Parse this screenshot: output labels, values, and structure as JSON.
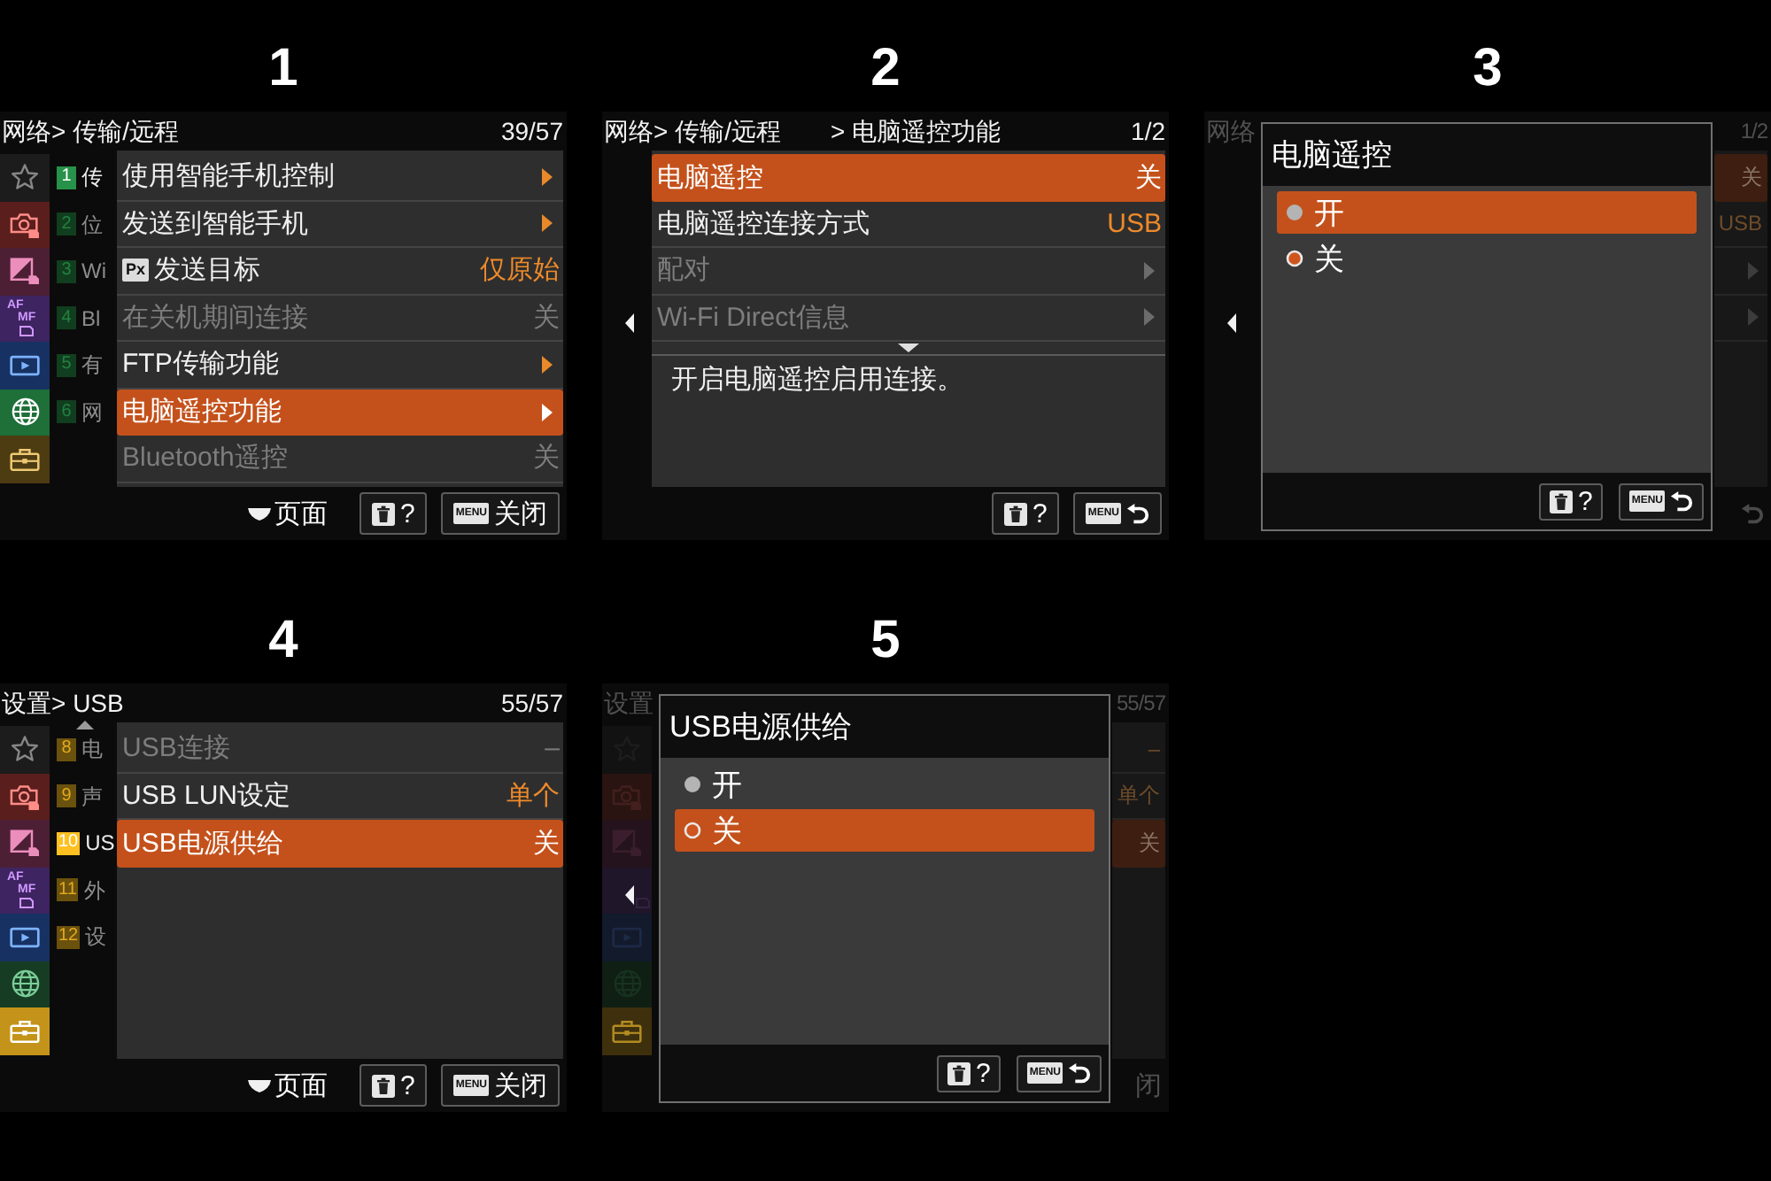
{
  "panels": [
    {
      "number": "1",
      "kind": "menu",
      "header": {
        "breadcrumb": [
          "网络> 传输/远程"
        ],
        "page": "39/57"
      },
      "categories": [
        {
          "kind": "favorites",
          "color": "#1c1c1c",
          "selected": false
        },
        {
          "kind": "camera",
          "color": "#5a1e1c",
          "selected": false
        },
        {
          "kind": "exposure",
          "color": "#4c1f35",
          "selected": false
        },
        {
          "kind": "focus",
          "color": "#3e2461",
          "selected": false,
          "texts": [
            "AF",
            "MF"
          ]
        },
        {
          "kind": "playback",
          "color": "#173162",
          "selected": false
        },
        {
          "kind": "network",
          "color": "#1e7038",
          "selected": true
        },
        {
          "kind": "setup",
          "color": "#4d3b12",
          "selected": false
        }
      ],
      "groups": [
        {
          "number": "1",
          "label": "传",
          "selected": true
        },
        {
          "number": "2",
          "label": "位",
          "selected": false
        },
        {
          "number": "3",
          "label": "Wi",
          "selected": false
        },
        {
          "number": "4",
          "label": "Bl",
          "selected": false
        },
        {
          "number": "5",
          "label": "有",
          "selected": false
        },
        {
          "number": "6",
          "label": "网",
          "selected": false
        }
      ],
      "rows": [
        {
          "kind": "submenu",
          "label": "使用智能手机控制",
          "selected": false,
          "disabled": false
        },
        {
          "kind": "submenu",
          "label": "发送到智能手机",
          "selected": false,
          "disabled": false
        },
        {
          "kind": "value",
          "tag": "Px",
          "label": "发送目标",
          "value": "仅原始",
          "selected": false,
          "disabled": false
        },
        {
          "kind": "value",
          "label": "在关机期间连接",
          "value": "关",
          "selected": false,
          "disabled": true
        },
        {
          "kind": "submenu",
          "label": "FTP传输功能",
          "selected": false,
          "disabled": false
        },
        {
          "kind": "submenu",
          "label": "电脑遥控功能",
          "selected": true,
          "disabled": false
        },
        {
          "kind": "value",
          "label": "Bluetooth遥控",
          "value": "关",
          "selected": false,
          "disabled": true
        }
      ],
      "footer": {
        "hint": "页面",
        "buttons": [
          {
            "kind": "help",
            "text": "?"
          },
          {
            "kind": "close",
            "tag": "MENU",
            "text": "关闭"
          }
        ]
      }
    },
    {
      "number": "2",
      "kind": "menu",
      "left_arrow": true,
      "header": {
        "breadcrumb": [
          "网络> 传输/远程",
          "> 电脑遥控功能"
        ],
        "page": "1/2"
      },
      "rows": [
        {
          "kind": "value",
          "label": "电脑遥控",
          "value": "关",
          "selected": true,
          "disabled": false
        },
        {
          "kind": "value",
          "label": "电脑遥控连接方式",
          "value": "USB",
          "selected": false,
          "disabled": false
        },
        {
          "kind": "submenu",
          "label": "配对",
          "selected": false,
          "disabled": true
        },
        {
          "kind": "submenu",
          "label": "Wi-Fi Direct信息",
          "selected": false,
          "disabled": true
        }
      ],
      "more_below": true,
      "description": "开启电脑遥控启用连接。",
      "footer": {
        "buttons": [
          {
            "kind": "help",
            "text": "?"
          },
          {
            "kind": "back",
            "tag": "MENU"
          }
        ]
      }
    },
    {
      "number": "3",
      "kind": "dialog",
      "left_arrow": true,
      "background": {
        "header": {
          "breadcrumb": [
            "网络"
          ],
          "page": "1/2"
        },
        "rows": [
          {
            "kind": "value",
            "value": "关",
            "selected": true
          },
          {
            "kind": "value",
            "value": "USB",
            "selected": false
          },
          {
            "kind": "submenu",
            "selected": false
          },
          {
            "kind": "submenu",
            "selected": false
          }
        ],
        "footer_fragment": {
          "kind": "back_arrow"
        }
      },
      "dialog": {
        "title": "电脑遥控",
        "options": [
          {
            "label": "开",
            "selected": true,
            "checked": false
          },
          {
            "label": "关",
            "selected": false,
            "checked": true
          }
        ],
        "buttons": [
          {
            "kind": "help",
            "text": "?"
          },
          {
            "kind": "back",
            "tag": "MENU"
          }
        ]
      }
    },
    {
      "number": "4",
      "kind": "menu",
      "header": {
        "breadcrumb": [
          "设置> USB"
        ],
        "page": "55/57"
      },
      "categories": [
        {
          "kind": "favorites",
          "color": "#1c1c1c",
          "selected": false
        },
        {
          "kind": "camera",
          "color": "#5a1e1c",
          "selected": false
        },
        {
          "kind": "exposure",
          "color": "#4c1f35",
          "selected": false
        },
        {
          "kind": "focus",
          "color": "#3e2461",
          "selected": false,
          "texts": [
            "AF",
            "MF"
          ]
        },
        {
          "kind": "playback",
          "color": "#173162",
          "selected": false
        },
        {
          "kind": "network",
          "color": "#163d24",
          "selected": false
        },
        {
          "kind": "setup",
          "color": "#c39419",
          "selected": true
        }
      ],
      "groups_scroll_up": true,
      "groups": [
        {
          "number": "8",
          "label": "电",
          "selected": false
        },
        {
          "number": "9",
          "label": "声",
          "selected": false
        },
        {
          "number": "10",
          "label": "US",
          "selected": true
        },
        {
          "number": "11",
          "label": "外",
          "selected": false
        },
        {
          "number": "12",
          "label": "设",
          "selected": false
        }
      ],
      "rows": [
        {
          "kind": "value",
          "label": "USB连接",
          "value": "–",
          "selected": false,
          "disabled": true
        },
        {
          "kind": "value",
          "label": "USB LUN设定",
          "value": "单个",
          "selected": false,
          "disabled": false
        },
        {
          "kind": "value",
          "label": "USB电源供给",
          "value": "关",
          "selected": true,
          "disabled": false
        }
      ],
      "footer": {
        "hint": "页面",
        "buttons": [
          {
            "kind": "help",
            "text": "?"
          },
          {
            "kind": "close",
            "tag": "MENU",
            "text": "关闭"
          }
        ]
      }
    },
    {
      "number": "5",
      "kind": "dialog",
      "left_arrow": true,
      "background": {
        "header": {
          "breadcrumb": [
            "设置"
          ],
          "page": "55/57"
        },
        "categories": [
          {
            "kind": "favorites",
            "color": "#121212",
            "selected": false
          },
          {
            "kind": "camera",
            "color": "#2a1412",
            "selected": false
          },
          {
            "kind": "exposure",
            "color": "#24131c",
            "selected": false
          },
          {
            "kind": "focus",
            "color": "#1f1629",
            "selected": false
          },
          {
            "kind": "playback",
            "color": "#121a2c",
            "selected": false
          },
          {
            "kind": "network",
            "color": "#0f1f14",
            "selected": false
          },
          {
            "kind": "setup",
            "color": "#3e300c",
            "selected": true
          }
        ],
        "rows": [
          {
            "kind": "value",
            "value": "–",
            "selected": false
          },
          {
            "kind": "value",
            "value": "单个",
            "selected": false
          },
          {
            "kind": "value",
            "value": "关",
            "selected": true
          }
        ],
        "footer_fragment": {
          "kind": "text",
          "text": "闭"
        }
      },
      "dialog": {
        "title": "USB电源供给",
        "options": [
          {
            "label": "开",
            "selected": false,
            "checked": false
          },
          {
            "label": "关",
            "selected": true,
            "checked": true
          }
        ],
        "buttons": [
          {
            "kind": "help",
            "text": "?"
          },
          {
            "kind": "back",
            "tag": "MENU"
          }
        ]
      }
    }
  ]
}
